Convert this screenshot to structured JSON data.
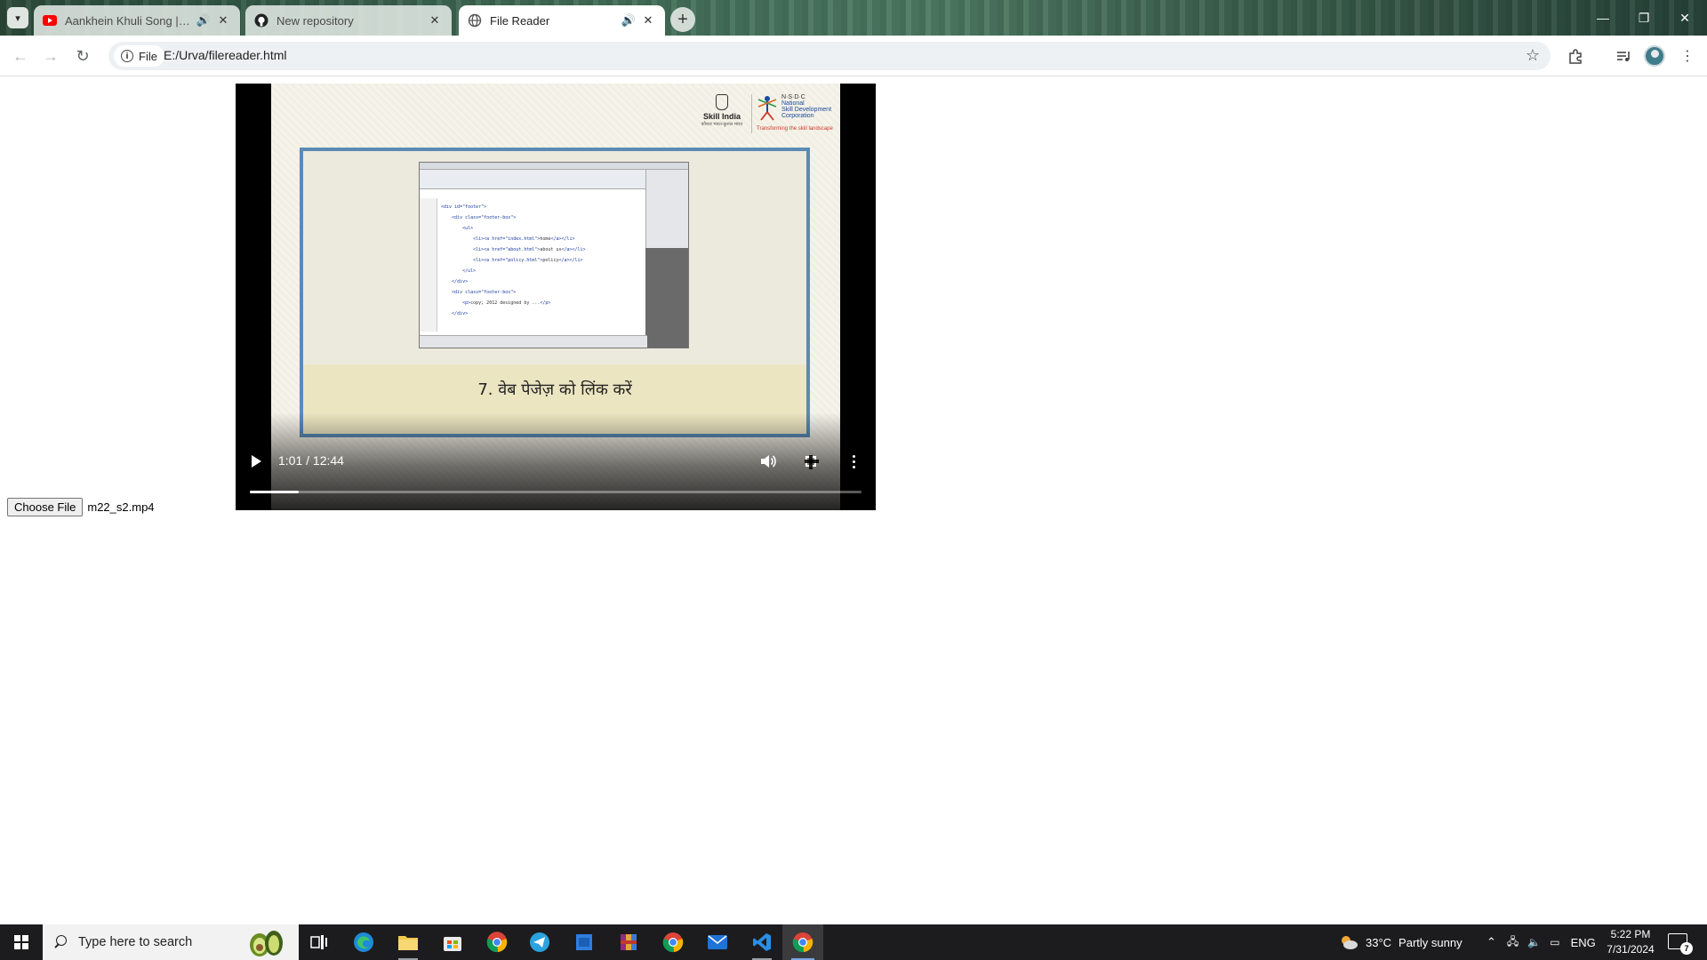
{
  "browser": {
    "tabs": [
      {
        "title": "Aankhein Khuli Song | Mohabbatein",
        "icon": "youtube-icon",
        "state": "inactive"
      },
      {
        "title": "New repository",
        "icon": "github-icon",
        "state": "inactive"
      },
      {
        "title": "File Reader",
        "icon": "globe-icon",
        "state": "active"
      }
    ],
    "address_chip": "File",
    "url": "E:/Urva/filereader.html"
  },
  "page": {
    "choose_file_label": "Choose File",
    "file_name": "m22_s2.mp4"
  },
  "video": {
    "current_time": "1:01",
    "duration": "12:44",
    "time_display": "1:01 / 12:44",
    "progress_fraction": 0.08,
    "slide": {
      "caption": "7. वेब पेजेज़ को लिंक करें",
      "logo_left_title": "Skill India",
      "logo_left_sub": "कौशल भारत-कुशल भारत",
      "logo_right_title": "N·S·D·C",
      "logo_right_lines": [
        "National",
        "Skill Development",
        "Corporation"
      ],
      "logo_right_tagline": "Transforming the skill landscape"
    }
  },
  "taskbar": {
    "search_placeholder": "Type here to search",
    "weather_temp": "33°C",
    "weather_text": "Partly sunny",
    "language": "ENG",
    "time": "5:22 PM",
    "date": "7/31/2024",
    "notification_count": "7"
  }
}
